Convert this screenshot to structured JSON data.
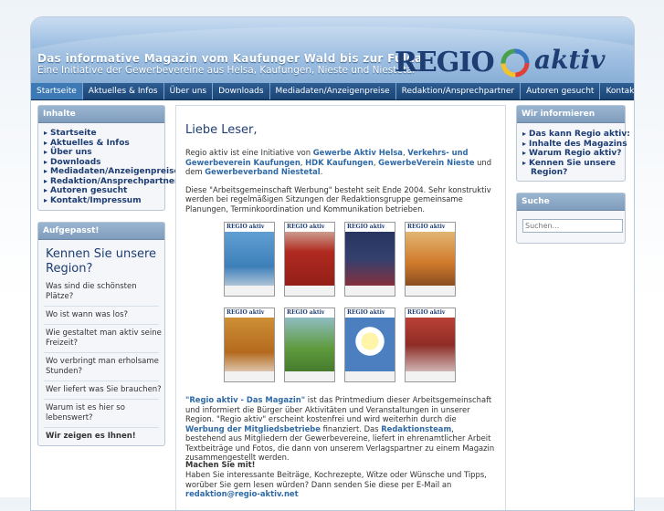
{
  "header": {
    "tagline": "Das informative Magazin vom Kaufunger Wald bis zur Fulda",
    "subtagline": "Eine Initiative der Gewerbevereine aus Helsa, Kaufungen, Nieste und Niestetal",
    "logo_regio": "REGIO",
    "logo_aktiv": "aktiv"
  },
  "nav": [
    "Startseite",
    "Aktuelles & Infos",
    "Über uns",
    "Downloads",
    "Mediadaten/Anzeigenpreise",
    "Redaktion/Ansprechpartner",
    "Autoren gesucht",
    "Kontakt/Impressum"
  ],
  "sidebar": {
    "inhalte_title": "Inhalte",
    "inhalte_items": [
      "Startseite",
      "Aktuelles & Infos",
      "Über uns",
      "Downloads",
      "Mediadaten/Anzeigenpreise",
      "Redaktion/Ansprechpartner",
      "Autoren gesucht",
      "Kontakt/Impressum"
    ],
    "aufgepasst_title": "Aufgepasst!",
    "aufgepasst_heading": "Kennen Sie unsere Region?",
    "questions": [
      "Was sind die schönsten Plätze?",
      "Wo ist wann was los?",
      "Wie gestaltet man aktiv seine Freizeit?",
      "Wo verbringt man erholsame Stunden?",
      "Wer liefert was Sie brauchen?",
      "Warum ist es hier so lebenswert?"
    ],
    "closing": "Wir zeigen es Ihnen!"
  },
  "main": {
    "heading": "Liebe Leser,",
    "p1_a": "Regio aktiv ist eine Initiative von ",
    "p1_l1": "Gewerbe Aktiv Helsa",
    "p1_b": ", ",
    "p1_l2": "Verkehrs- und Gewerbeverein Kaufungen",
    "p1_c": ", ",
    "p1_l3": "HDK Kaufungen",
    "p1_d": ", ",
    "p1_l4": "GewerbeVerein Nieste",
    "p1_e": " und dem ",
    "p1_l5": "Gewerbeverband Niestetal",
    "p1_f": ".",
    "p2": "Diese \"Arbeitsgemeinschaft Werbung\" besteht seit Ende 2004. Sehr konstruktiv werden bei regelmäßigen Sitzungen der Redaktionsgruppe gemeinsame Planungen, Terminkoordination und Kommunikation betrieben.",
    "p3_l1": "\"Regio aktiv - Das Magazin\"",
    "p3_a": " ist das Printmedium dieser Arbeitsgemeinschaft und informiert die Bürger über Aktivitäten und Veranstaltungen in unserer Region. \"Regio aktiv\" erscheint kostenfrei und wird weiterhin durch die ",
    "p3_l2": "Werbung der Mitgliedsbetriebe",
    "p3_b": " finanziert. Das ",
    "p3_l3": "Redaktionsteam",
    "p3_c": ", bestehend aus Mitgliedern der Gewerbevereine, liefert in ehrenamtlicher Arbeit Textbeiträge und Fotos, die dann von unserem Verlagspartner zu einem Magazin zusammengestellt werden.",
    "p4_title": "Machen Sie mit!",
    "p4_text": "Haben Sie interessante Beiträge, Kochrezepte, Witze oder Wünsche und Tipps, worüber Sie gern lesen würden? Dann senden Sie diese per E-Mail an",
    "p4_email": "redaktion@regio-aktiv.net",
    "magazine_label": "REGIO aktiv"
  },
  "right": {
    "info_title": "Wir informieren",
    "info_items": [
      "Das kann Regio aktiv:",
      "Inhalte des Magazins",
      "Warum Regio aktiv?",
      "Kennen Sie unsere Region?"
    ],
    "search_title": "Suche",
    "search_placeholder": "Suchen..."
  }
}
